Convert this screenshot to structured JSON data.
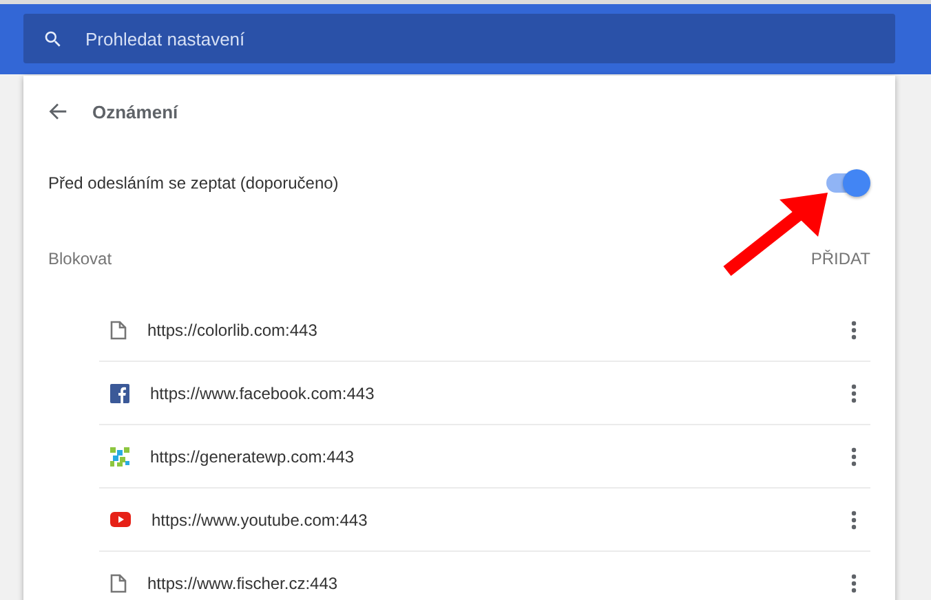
{
  "search": {
    "placeholder": "Prohledat nastavení"
  },
  "page": {
    "title": "Oznámení"
  },
  "setting": {
    "label": "Před odesláním se zeptat (doporučeno)",
    "on": true
  },
  "block": {
    "title": "Blokovat",
    "add": "PŘIDAT",
    "sites": [
      {
        "url": "https://colorlib.com:443",
        "kind": "page"
      },
      {
        "url": "https://www.facebook.com:443",
        "kind": "facebook"
      },
      {
        "url": "https://generatewp.com:443",
        "kind": "mosaic"
      },
      {
        "url": "https://www.youtube.com:443",
        "kind": "video"
      },
      {
        "url": "https://www.fischer.cz:443",
        "kind": "page"
      }
    ]
  },
  "annotation": {
    "kind": "arrow"
  }
}
